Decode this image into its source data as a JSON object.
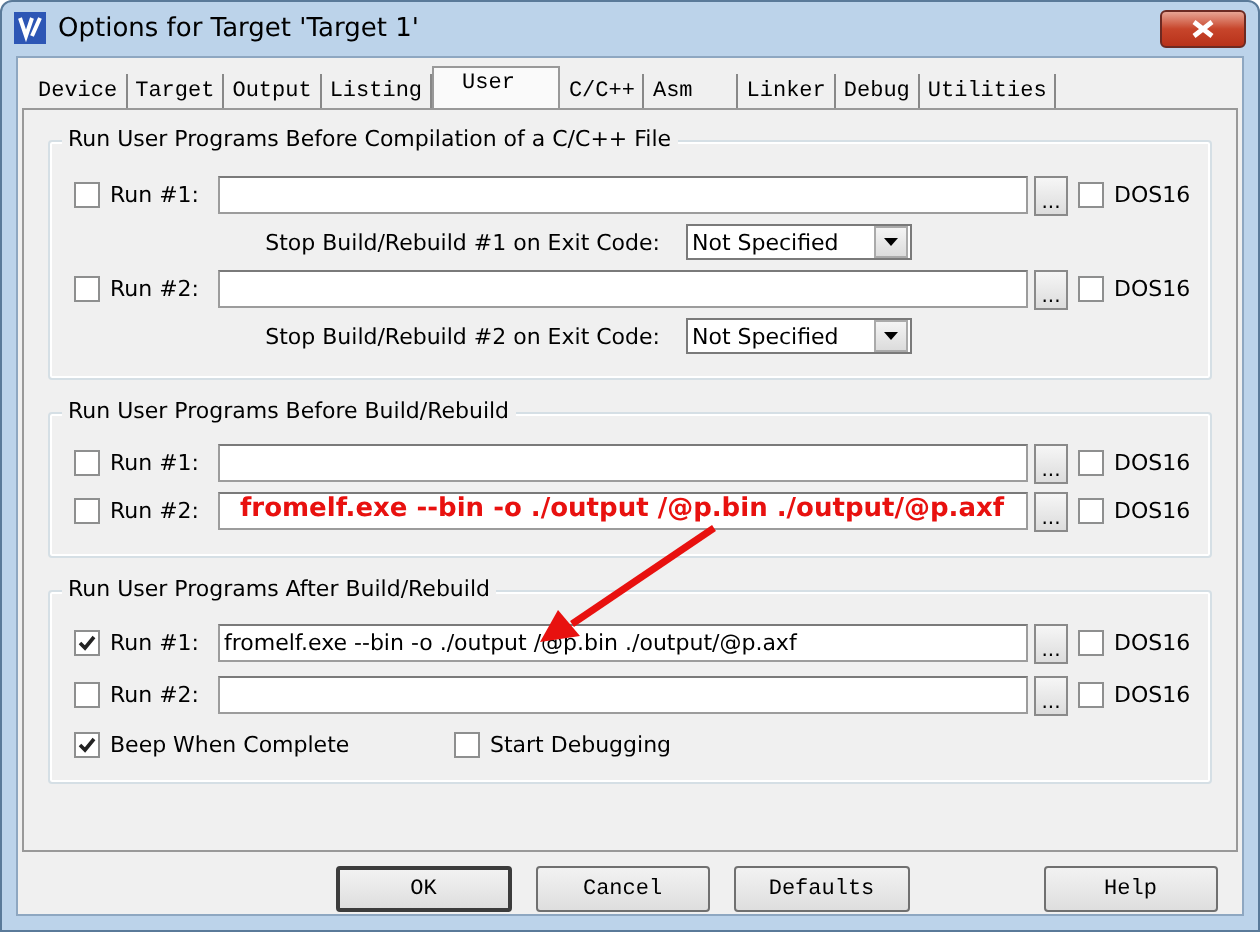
{
  "window": {
    "title": "Options for Target 'Target 1'"
  },
  "tabs": [
    {
      "label": "Device",
      "selected": false
    },
    {
      "label": "Target",
      "selected": false
    },
    {
      "label": "Output",
      "selected": false
    },
    {
      "label": "Listing",
      "selected": false
    },
    {
      "label": "User",
      "selected": true
    },
    {
      "label": "C/C++",
      "selected": false
    },
    {
      "label": "Asm",
      "selected": false
    },
    {
      "label": "Linker",
      "selected": false
    },
    {
      "label": "Debug",
      "selected": false
    },
    {
      "label": "Utilities",
      "selected": false
    }
  ],
  "groups": [
    {
      "title": "Run User Programs Before Compilation of a C/C++ File",
      "rows": [
        {
          "kind": "program",
          "label": "Run #1:",
          "checked": false,
          "value": "",
          "browse": "...",
          "dos16_label": "DOS16",
          "dos16": false
        },
        {
          "kind": "exit_code",
          "label": "Stop Build/Rebuild #1 on Exit Code:",
          "value": "Not Specified"
        },
        {
          "kind": "program",
          "label": "Run #2:",
          "checked": false,
          "value": "",
          "browse": "...",
          "dos16_label": "DOS16",
          "dos16": false
        },
        {
          "kind": "exit_code",
          "label": "Stop Build/Rebuild #2 on Exit Code:",
          "value": "Not Specified"
        }
      ]
    },
    {
      "title": "Run User Programs Before Build/Rebuild",
      "rows": [
        {
          "kind": "program",
          "label": "Run #1:",
          "checked": false,
          "value": "",
          "browse": "...",
          "dos16_label": "DOS16",
          "dos16": false
        },
        {
          "kind": "program",
          "label": "Run #2:",
          "checked": false,
          "value": "",
          "annotation": "fromelf.exe --bin -o ./output /@p.bin ./output/@p.axf",
          "browse": "...",
          "dos16_label": "DOS16",
          "dos16": false
        }
      ]
    },
    {
      "title": "Run User Programs After Build/Rebuild",
      "rows": [
        {
          "kind": "program",
          "label": "Run #1:",
          "checked": true,
          "value": "fromelf.exe --bin -o ./output /@p.bin ./output/@p.axf",
          "browse": "...",
          "dos16_label": "DOS16",
          "dos16": false
        },
        {
          "kind": "program",
          "label": "Run #2:",
          "checked": false,
          "value": "",
          "browse": "...",
          "dos16_label": "DOS16",
          "dos16": false
        },
        {
          "kind": "options",
          "items": [
            {
              "label": "Beep When Complete",
              "checked": true
            },
            {
              "label": "Start Debugging",
              "checked": false
            }
          ]
        }
      ]
    }
  ],
  "buttons": [
    {
      "label": "OK",
      "default": true
    },
    {
      "label": "Cancel",
      "default": false
    },
    {
      "label": "Defaults",
      "default": false
    },
    {
      "label": "Help",
      "default": false
    }
  ]
}
